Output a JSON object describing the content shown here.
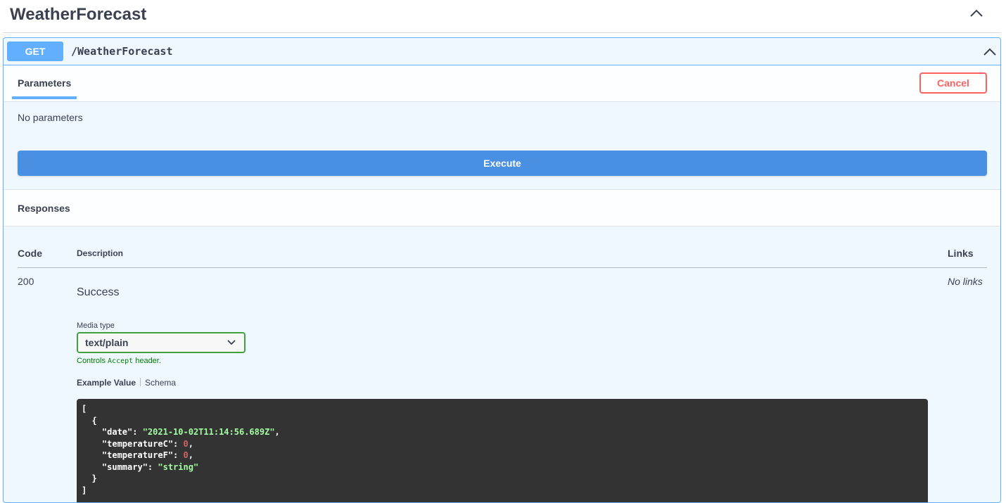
{
  "tag": {
    "title": "WeatherForecast",
    "toggle_icon": "chevron-up-icon"
  },
  "operation": {
    "method": "GET",
    "path": "/WeatherForecast",
    "toggle_icon": "chevron-up-icon"
  },
  "parameters": {
    "tab_label": "Parameters",
    "cancel_label": "Cancel",
    "empty_text": "No parameters",
    "execute_label": "Execute"
  },
  "responses": {
    "title": "Responses",
    "columns": {
      "code": "Code",
      "description": "Description",
      "links": "Links"
    },
    "rows": [
      {
        "code": "200",
        "description": "Success",
        "links": "No links",
        "media_type_label": "Media type",
        "media_type_value": "text/plain",
        "hint_prefix": "Controls ",
        "hint_code": "Accept",
        "hint_suffix": " header.",
        "tab_example": "Example Value",
        "tab_schema": "Schema",
        "example_lines": [
          "[",
          "  {",
          "    \"date\": \"2021-10-02T11:14:56.689Z\",",
          "    \"temperatureC\": 0,",
          "    \"temperatureF\": 0,",
          "    \"summary\": \"string\"",
          "  }",
          "]"
        ]
      }
    ]
  },
  "colors": {
    "get_accent": "#61affe",
    "execute_bg": "#4990e2",
    "cancel": "#ff6060",
    "media_border": "#41a141",
    "code_bg": "#333333",
    "code_string": "#a2fca2",
    "code_number": "#d36363"
  }
}
